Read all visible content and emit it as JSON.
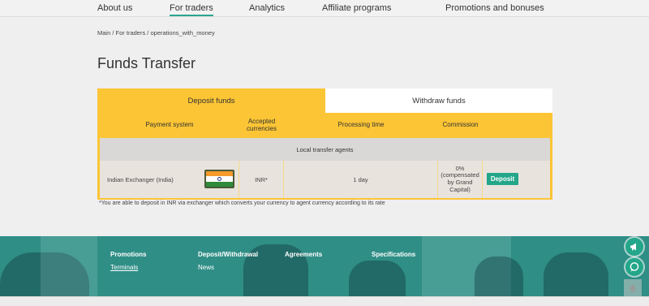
{
  "nav": {
    "items": [
      "About us",
      "For traders",
      "Analytics",
      "Affiliate programs",
      "Promotions and bonuses"
    ],
    "active": "For traders"
  },
  "breadcrumb": [
    "Main",
    "For traders",
    "operations_with_money"
  ],
  "breadcrumb_sep": " / ",
  "page": {
    "title": "Funds Transfer"
  },
  "tabs": {
    "deposit": "Deposit funds",
    "withdraw": "Withdraw funds"
  },
  "table": {
    "headers": {
      "payment_system": "Payment system",
      "accepted_currencies": "Accepted currencies",
      "processing_time": "Processing time",
      "commission": "Commission"
    },
    "group": "Local transfer agents",
    "row": {
      "name": "Indian Exchanger (India)",
      "currency": "INR*",
      "processing": "1 day",
      "commission": "0% (compensated by Grand Capital)",
      "action": "Deposit"
    }
  },
  "footnote": "*You are able to deposit in INR via exchanger which converts your currency to agent currency according to its rate",
  "footer": {
    "links": [
      "Promotions",
      "Deposit/Withdrawal",
      "Agreements",
      "Specifications",
      "Terminals",
      "News"
    ]
  },
  "colors": {
    "accent": "#fcc535",
    "brand": "#23a689",
    "footer_bg": "#2f8e86"
  },
  "icons": {
    "flag": "india-flag-icon",
    "megaphone": "megaphone-icon",
    "chat": "chat-icon",
    "scroll": "arrow-up-icon"
  }
}
